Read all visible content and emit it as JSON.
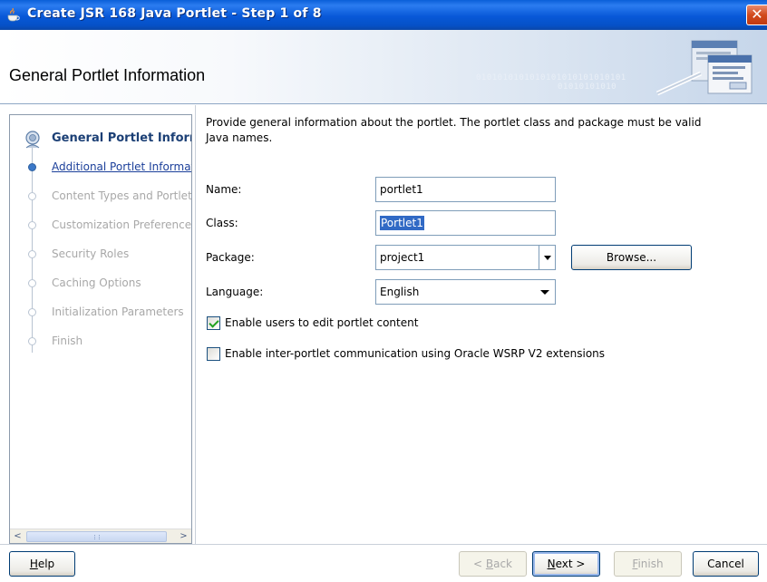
{
  "window": {
    "title": "Create JSR 168 Java Portlet - Step 1 of 8",
    "close_glyph": "✕"
  },
  "header": {
    "title": "General Portlet Information",
    "binary_text": "0101010101010101010101010101",
    "binary_text2": "01010101010"
  },
  "nav": {
    "items": [
      {
        "label": "General Portlet Information",
        "state": "current"
      },
      {
        "label": "Additional Portlet Information",
        "state": "link"
      },
      {
        "label": "Content Types and Portlet Modes",
        "state": "disabled"
      },
      {
        "label": "Customization Preferences",
        "state": "disabled"
      },
      {
        "label": "Security Roles",
        "state": "disabled"
      },
      {
        "label": "Caching Options",
        "state": "disabled"
      },
      {
        "label": "Initialization Parameters",
        "state": "disabled"
      },
      {
        "label": "Finish",
        "state": "disabled"
      }
    ],
    "scroll_left": "<",
    "scroll_right": ">"
  },
  "form": {
    "description": "Provide general information about the portlet. The portlet class and package must be valid Java names.",
    "name_label": "Name:",
    "name_value": "portlet1",
    "class_label": "Class:",
    "class_value": "Portlet1",
    "package_label": "Package:",
    "package_value": "project1",
    "browse_label": "Browse...",
    "language_label": "Language:",
    "language_value": "English",
    "enable_edit_label": "Enable users to edit portlet content",
    "enable_edit_checked": true,
    "enable_ipc_label": "Enable inter-portlet communication using Oracle WSRP V2 extensions",
    "enable_ipc_checked": false
  },
  "footer": {
    "help": {
      "pre": "",
      "mnemonic": "H",
      "post": "elp"
    },
    "back": {
      "pre": "< ",
      "mnemonic": "B",
      "post": "ack"
    },
    "next": {
      "pre": "",
      "mnemonic": "N",
      "post": "ext >"
    },
    "finish": {
      "pre": "",
      "mnemonic": "F",
      "post": "inish"
    },
    "cancel": "Cancel"
  },
  "colors": {
    "titlebar": "#0858d8",
    "accent": "#316ac5",
    "current_step": "#1b3f75",
    "disabled_text": "#a8a8a8"
  }
}
